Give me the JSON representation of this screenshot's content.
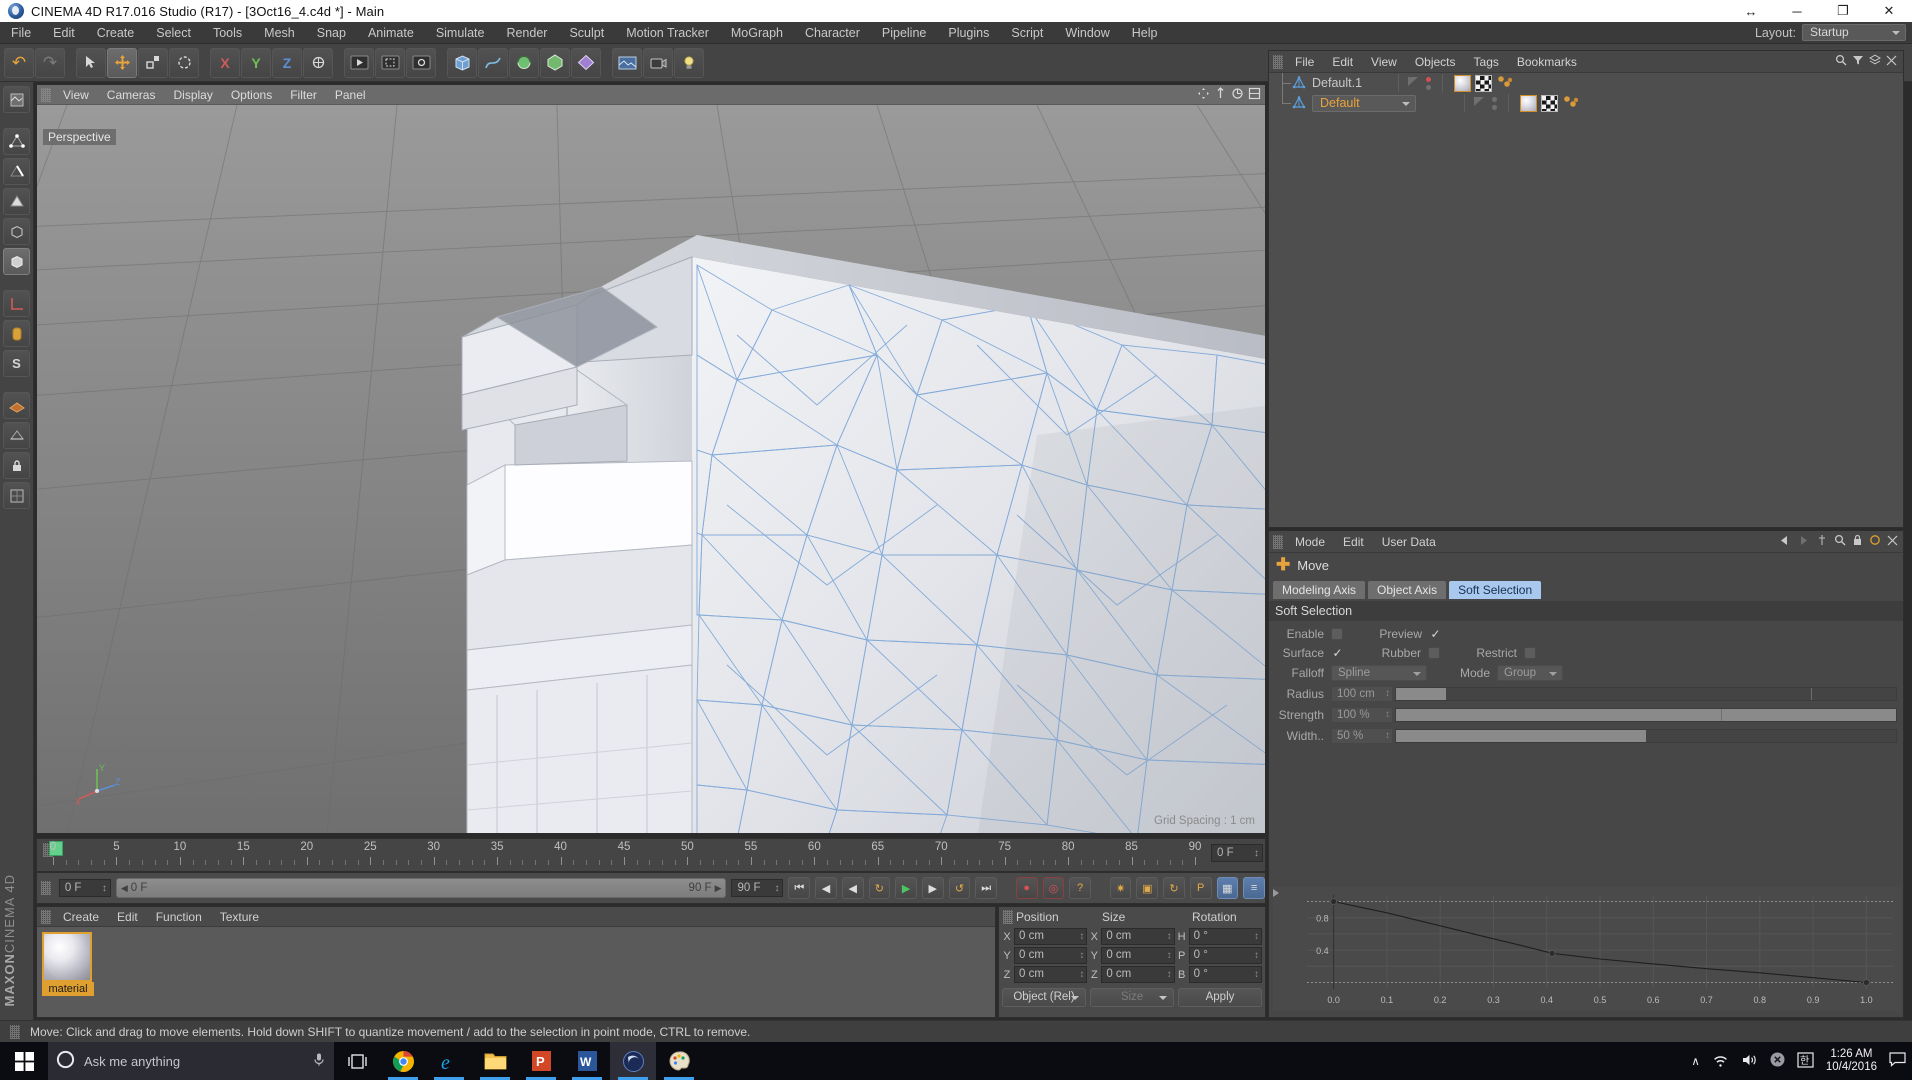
{
  "window": {
    "title": "CINEMA 4D R17.016 Studio (R17) - [3Oct16_4.c4d *] - Main",
    "app_icon": "cinema4d-logo-icon",
    "buttons": {
      "restore_down_label": "↔",
      "minimize_label": "─",
      "maximize_label": "❐",
      "close_label": "✕"
    }
  },
  "menubar": {
    "items": [
      {
        "label": "File"
      },
      {
        "label": "Edit"
      },
      {
        "label": "Create"
      },
      {
        "label": "Select"
      },
      {
        "label": "Tools"
      },
      {
        "label": "Mesh"
      },
      {
        "label": "Snap"
      },
      {
        "label": "Animate"
      },
      {
        "label": "Simulate"
      },
      {
        "label": "Render"
      },
      {
        "label": "Sculpt"
      },
      {
        "label": "Motion Tracker"
      },
      {
        "label": "MoGraph"
      },
      {
        "label": "Character"
      },
      {
        "label": "Pipeline"
      },
      {
        "label": "Plugins"
      },
      {
        "label": "Script"
      },
      {
        "label": "Window"
      },
      {
        "label": "Help"
      }
    ],
    "layout_label": "Layout:",
    "layout_value": "Startup"
  },
  "toolbar": {
    "buttons": [
      {
        "name": "undo-button",
        "glyph": "↶"
      },
      {
        "name": "redo-button",
        "glyph": "↷"
      },
      {
        "name": "live-selection-button",
        "glyph": "⬚"
      },
      {
        "name": "move-tool-button",
        "glyph": "✥"
      },
      {
        "name": "scale-tool-button",
        "glyph": "⬜"
      },
      {
        "name": "rotate-tool-button",
        "glyph": "↺"
      },
      {
        "name": "move-axis-button",
        "glyph": "✛"
      },
      {
        "name": "lock-x-axis-button",
        "glyph": "X"
      },
      {
        "name": "lock-y-axis-button",
        "glyph": "Y"
      },
      {
        "name": "lock-z-axis-button",
        "glyph": "Z"
      },
      {
        "name": "world-object-coordinates-button",
        "glyph": "⬚"
      },
      {
        "name": "render-view-button",
        "glyph": "▣"
      },
      {
        "name": "render-region-button",
        "glyph": "▤"
      },
      {
        "name": "render-settings-button",
        "glyph": "▥"
      },
      {
        "name": "cube-primitive-button",
        "glyph": "⬛"
      },
      {
        "name": "spline-pen-button",
        "glyph": "✎"
      },
      {
        "name": "nurbs-generator-button",
        "glyph": "◑"
      },
      {
        "name": "array-modeling-button",
        "glyph": "⬢"
      },
      {
        "name": "deformer-button",
        "glyph": "◆"
      },
      {
        "name": "environment-button",
        "glyph": "▦"
      },
      {
        "name": "camera-button",
        "glyph": "▰"
      },
      {
        "name": "light-button",
        "glyph": "☀"
      }
    ]
  },
  "left_toolbar": {
    "buttons": [
      {
        "name": "texture-tool-button",
        "glyph": "▨"
      },
      {
        "name": "point-mode-button",
        "glyph": "◇"
      },
      {
        "name": "edge-mode-button",
        "glyph": "⬟"
      },
      {
        "name": "polygon-mode-button",
        "glyph": "▱"
      },
      {
        "name": "model-mode-button",
        "glyph": "⬡"
      },
      {
        "name": "object-mode-button",
        "glyph": "⬛"
      },
      {
        "name": "object-axis-mode-button",
        "glyph": "⬜"
      },
      {
        "name": "enable-axis-button",
        "glyph": "L"
      },
      {
        "name": "viewport-solo-button",
        "glyph": "⬚"
      },
      {
        "name": "snap-settings-button",
        "glyph": "S"
      },
      {
        "name": "workplane-button",
        "glyph": "◧"
      },
      {
        "name": "quantize-button",
        "glyph": "⬚"
      },
      {
        "name": "lock-workplane-button",
        "glyph": "🔒"
      },
      {
        "name": "planar-workplane-button",
        "glyph": "◫"
      }
    ],
    "brand_top": "MAXON",
    "brand_bottom": "CINEMA 4D"
  },
  "viewport": {
    "menu": [
      {
        "label": "View"
      },
      {
        "label": "Cameras"
      },
      {
        "label": "Display"
      },
      {
        "label": "Options"
      },
      {
        "label": "Filter"
      },
      {
        "label": "Panel"
      }
    ],
    "label": "Perspective",
    "grid_spacing": "Grid Spacing : 1 cm",
    "axis_labels": {
      "x": "X",
      "y": "Y",
      "z": "Z"
    }
  },
  "timeline": {
    "ticks": [
      0,
      5,
      10,
      15,
      20,
      25,
      30,
      35,
      40,
      45,
      50,
      55,
      60,
      65,
      70,
      75,
      80,
      85,
      90
    ],
    "min_frame": 0,
    "max_frame": 90,
    "current_frame_field": "0 F",
    "playhead_frame": 0
  },
  "playbar": {
    "current_frame": "0 F",
    "range_start": "0 F",
    "range_end": "90 F",
    "end_frame": "90 F",
    "buttons": [
      {
        "name": "go-to-start-button",
        "glyph": "⏮"
      },
      {
        "name": "step-back-button",
        "glyph": "◀"
      },
      {
        "name": "play-reverse-button",
        "glyph": "◀"
      },
      {
        "name": "loop-button",
        "glyph": "↺"
      },
      {
        "name": "play-button",
        "glyph": "▶"
      },
      {
        "name": "step-forward-button",
        "glyph": "▶"
      },
      {
        "name": "go-to-end-button",
        "glyph": "⏭"
      },
      {
        "name": "record-active-objects-button",
        "glyph": "●"
      },
      {
        "name": "autokeying-button",
        "glyph": "●"
      },
      {
        "name": "keyframe-selection-button",
        "glyph": "?"
      },
      {
        "name": "position-key-button",
        "glyph": "✥"
      },
      {
        "name": "scale-key-button",
        "glyph": "▢"
      },
      {
        "name": "rotation-key-button",
        "glyph": "↻"
      },
      {
        "name": "parameter-key-button",
        "glyph": "P"
      },
      {
        "name": "point-level-animation-button",
        "glyph": "▦"
      },
      {
        "name": "timeline-toggle-button",
        "glyph": "≡"
      }
    ]
  },
  "material_manager": {
    "menu": [
      {
        "label": "Create"
      },
      {
        "label": "Edit"
      },
      {
        "label": "Function"
      },
      {
        "label": "Texture"
      }
    ],
    "materials": [
      {
        "name": "material"
      }
    ]
  },
  "coordinates": {
    "headers": [
      "Position",
      "Size",
      "Rotation"
    ],
    "rows": [
      {
        "pos_axis": "X",
        "pos_value": "0 cm",
        "size_axis": "X",
        "size_value": "0 cm",
        "rot_axis": "H",
        "rot_value": "0 °"
      },
      {
        "pos_axis": "Y",
        "pos_value": "0 cm",
        "size_axis": "Y",
        "size_value": "0 cm",
        "rot_axis": "P",
        "rot_value": "0 °"
      },
      {
        "pos_axis": "Z",
        "pos_value": "0 cm",
        "size_axis": "Z",
        "size_value": "0 cm",
        "rot_axis": "B",
        "rot_value": "0 °"
      }
    ],
    "mode_dropdown": "Object (Rel)",
    "size_dropdown": "Size",
    "apply_button": "Apply"
  },
  "status_bar": {
    "message": "Move: Click and drag to move elements. Hold down SHIFT to quantize movement / add to the selection in point mode, CTRL to remove."
  },
  "object_manager": {
    "menu": [
      {
        "label": "File"
      },
      {
        "label": "Edit"
      },
      {
        "label": "View"
      },
      {
        "label": "Objects"
      },
      {
        "label": "Tags"
      },
      {
        "label": "Bookmarks"
      }
    ],
    "objects": [
      {
        "name": "Default.1",
        "selected": false,
        "icon": "light-object-icon"
      },
      {
        "name": "Default",
        "selected": true,
        "icon": "light-object-icon"
      }
    ]
  },
  "attribute_manager": {
    "menu": [
      {
        "label": "Mode"
      },
      {
        "label": "Edit"
      },
      {
        "label": "User Data"
      }
    ],
    "tool_name": "Move",
    "tabs": [
      {
        "label": "Modeling Axis",
        "active": false
      },
      {
        "label": "Object Axis",
        "active": false
      },
      {
        "label": "Soft Selection",
        "active": true
      }
    ],
    "section_title": "Soft Selection",
    "fields": {
      "enable_label": "Enable",
      "enable_checked": false,
      "preview_label": "Preview",
      "preview_checked": true,
      "surface_label": "Surface",
      "surface_checked": true,
      "rubber_label": "Rubber",
      "rubber_checked": false,
      "restrict_label": "Restrict",
      "restrict_checked": false,
      "falloff_label": "Falloff",
      "falloff_value": "Spline",
      "mode_label": "Mode",
      "mode_value": "Group",
      "radius_label": "Radius",
      "radius_value": "100 cm",
      "radius_fill_pct": 10,
      "strength_label": "Strength",
      "strength_value": "100 %",
      "strength_fill_pct": 100,
      "width_label": "Width..",
      "width_value": "50 %",
      "width_fill_pct": 50
    }
  },
  "chart_data": {
    "type": "line",
    "title": "",
    "xlabel": "",
    "ylabel": "",
    "xlim": [
      -0.05,
      1.05
    ],
    "ylim": [
      -0.08,
      1.08
    ],
    "xticks": [
      "0.0",
      "0.1",
      "0.2",
      "0.3",
      "0.4",
      "0.5",
      "0.6",
      "0.7",
      "0.8",
      "0.9",
      "1.0"
    ],
    "xtick_values": [
      0.0,
      0.1,
      0.2,
      0.3,
      0.4,
      0.5,
      0.6,
      0.7,
      0.8,
      0.9,
      1.0
    ],
    "yticks": [
      "0.4",
      "0.8"
    ],
    "ytick_values": [
      0.4,
      0.8
    ],
    "grid": true,
    "legend": "none",
    "series": [
      {
        "name": "Falloff Spline",
        "x": [
          0.0,
          0.05,
          0.1,
          0.15,
          0.2,
          0.25,
          0.3,
          0.35,
          0.41,
          0.5,
          0.6,
          0.7,
          0.8,
          0.9,
          1.0
        ],
        "y": [
          1.0,
          0.93,
          0.86,
          0.78,
          0.7,
          0.62,
          0.54,
          0.46,
          0.36,
          0.29,
          0.23,
          0.17,
          0.12,
          0.06,
          0.0
        ]
      }
    ],
    "control_points": [
      {
        "x": 0.0,
        "y": 1.0
      },
      {
        "x": 0.41,
        "y": 0.36
      },
      {
        "x": 1.0,
        "y": 0.0
      }
    ]
  },
  "taskbar": {
    "start_label": "start-icon",
    "search_placeholder": "Ask me anything",
    "items": [
      {
        "name": "task-view-icon"
      },
      {
        "name": "chrome-icon",
        "running": true
      },
      {
        "name": "internet-explorer-icon",
        "running": true
      },
      {
        "name": "file-explorer-icon",
        "running": true
      },
      {
        "name": "powerpoint-icon",
        "running": true
      },
      {
        "name": "word-icon",
        "running": true
      },
      {
        "name": "cinema4d-icon",
        "running": true,
        "active": true
      },
      {
        "name": "paint-icon",
        "running": true
      }
    ],
    "tray": {
      "chevron": "∧",
      "network": "network-icon",
      "volume": "volume-icon",
      "action_center": "action-center-icon",
      "ime": "ime-icon",
      "time": "1:26 AM",
      "date": "10/4/2016"
    }
  }
}
